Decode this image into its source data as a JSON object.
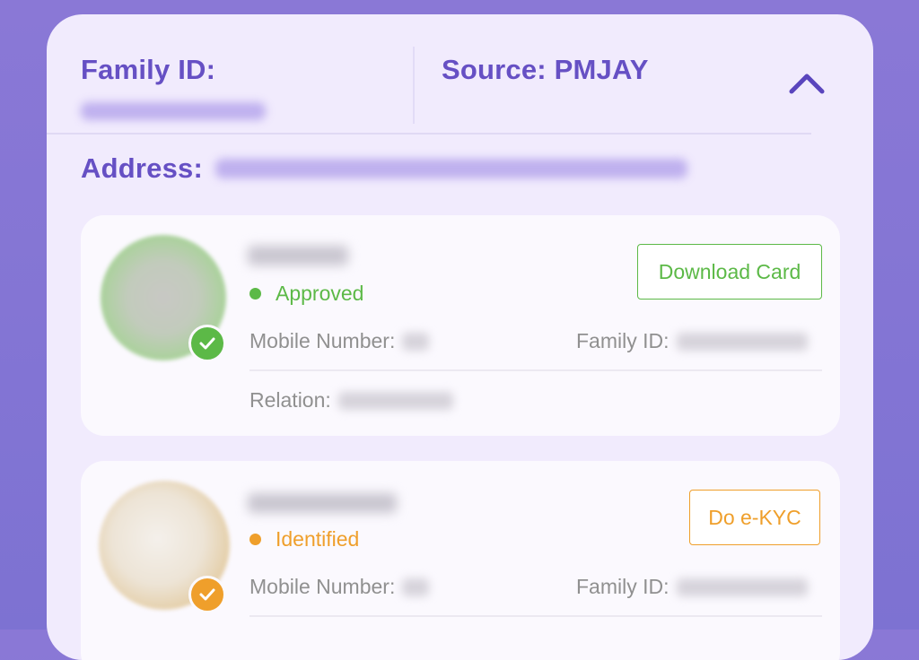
{
  "household": {
    "family_id_label": "Family ID:",
    "source_label": "Source: PMJAY",
    "address_label": "Address:"
  },
  "members": [
    {
      "status": "Approved",
      "status_color": "#5cb947",
      "action_label": "Download Card",
      "mobile_label": "Mobile Number:",
      "family_id_label": "Family ID:",
      "relation_label": "Relation:"
    },
    {
      "status": "Identified",
      "status_color": "#ef9f2b",
      "action_label": "Do e-KYC",
      "mobile_label": "Mobile Number:",
      "family_id_label": "Family ID:"
    }
  ],
  "icons": [
    "chevron-up-icon",
    "check-icon"
  ],
  "colors": {
    "accent": "#6650c4",
    "approved": "#5cb947",
    "identified": "#ef9f2b",
    "background": "#8a78d6"
  }
}
